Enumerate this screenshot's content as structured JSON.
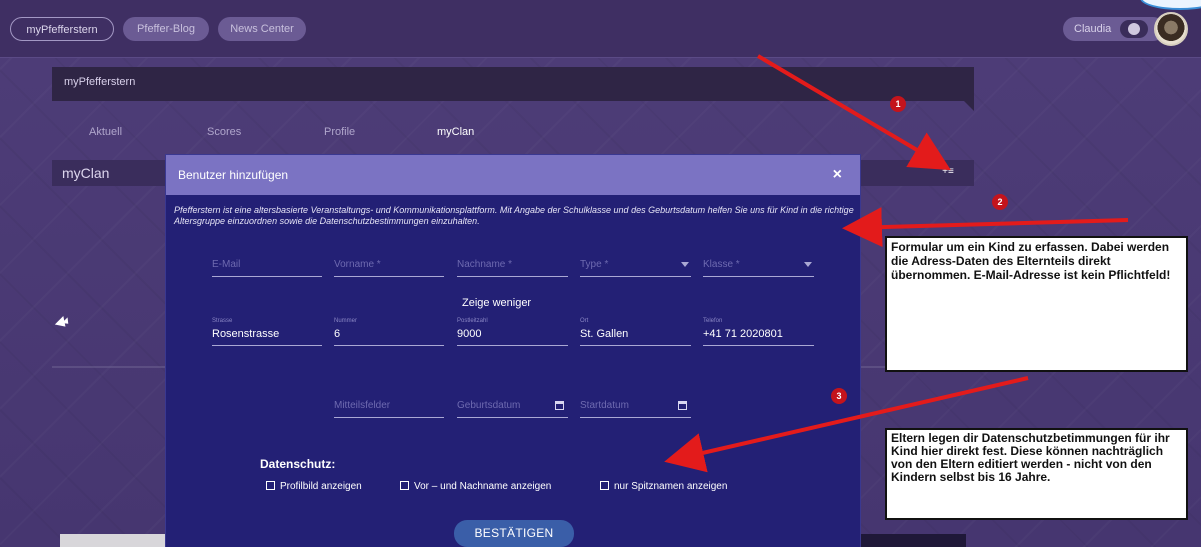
{
  "topbar": {
    "nav": [
      "myPfefferstern",
      "Pfeffer-Blog",
      "News Center"
    ],
    "user_name": "Claudia"
  },
  "page": {
    "section_title": "myPfefferstern",
    "tabs": [
      "Aktuell",
      "Scores",
      "Profile",
      "myClan"
    ],
    "active_tab": "myClan",
    "clan_title": "myClan",
    "add_user_icon": "add-user-icon"
  },
  "modal": {
    "title": "Benutzer hinzufügen",
    "close_label": "×",
    "description": "Pfefferstern ist eine altersbasierte Veranstaltungs- und Kommunikationsplattform. Mit Angabe der Schulklasse und des Geburtsdatum helfen Sie uns für Kind in die richtige Altersgruppe einzuordnen sowie die Datenschutzbestimmungen einzuhalten.",
    "row1": [
      {
        "placeholder": "E-Mail"
      },
      {
        "placeholder": "Vorname *"
      },
      {
        "placeholder": "Nachname *"
      },
      {
        "placeholder": "Type *"
      },
      {
        "placeholder": "Klasse *"
      }
    ],
    "toggle_label": "Zeige weniger",
    "address": [
      {
        "label": "Strasse",
        "value": "Rosenstrasse"
      },
      {
        "label": "Nummer",
        "value": "6"
      },
      {
        "label": "Postleitzahl",
        "value": "9000"
      },
      {
        "label": "Ort",
        "value": "St. Gallen"
      },
      {
        "label": "Telefon",
        "value": "+41 71 2020801"
      }
    ],
    "row3": [
      {
        "placeholder": "Mitteilsfelder"
      },
      {
        "placeholder": "Geburtsdatum"
      },
      {
        "placeholder": "Startdatum"
      }
    ],
    "privacy_title": "Datenschutz:",
    "privacy_options": [
      "Profilbild anzeigen",
      "Vor – und Nachname anzeigen",
      "nur Spitznamen anzeigen"
    ],
    "confirm_label": "BESTÄTIGEN"
  },
  "annotations": {
    "badges": [
      "1",
      "2",
      "3"
    ],
    "note1": "Formular um ein Kind zu erfassen. Dabei werden die Adress-Daten des Elternteils direkt übernommen. E-Mail-Adresse ist kein Pflichtfeld!",
    "note2": "Eltern legen dir Datenschutzbetimmungen für ihr Kind hier direkt fest. Diese können nachträglich von den Eltern editiert werden - nicht von den Kindern selbst bis 16 Jahre.",
    "arrow_color": "#e31b1b"
  }
}
